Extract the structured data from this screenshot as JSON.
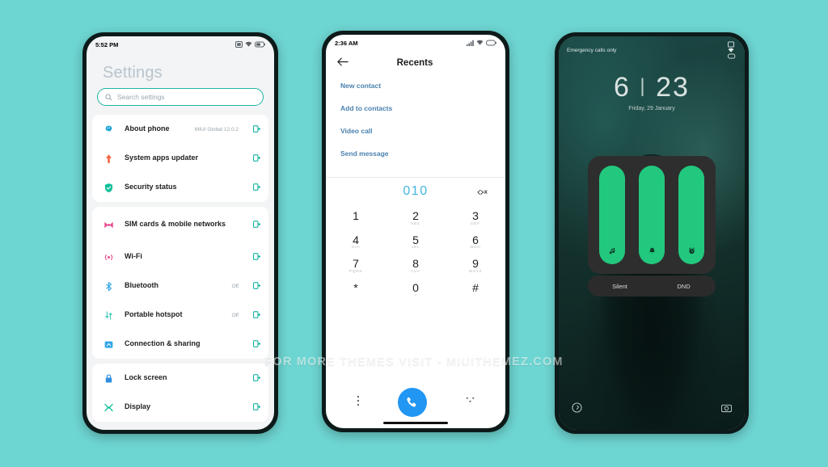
{
  "background_color": "#6ed6d2",
  "watermark": "FOR MORE THEMES VISIT - MIUITHEMEZ.COM",
  "accent_colors": {
    "teal": "#16b5a3",
    "link_blue": "#4a81ad",
    "dial_blue": "#44b6e0",
    "call_button": "#2196f3",
    "volume_green": "#22c87e"
  },
  "settings_phone": {
    "status_bar": {
      "time": "5:52 PM",
      "icons": [
        "sim-icon",
        "wifi-icon",
        "battery-icon"
      ]
    },
    "title": "Settings",
    "search": {
      "placeholder": "Search settings",
      "icon": "search-icon"
    },
    "groups": [
      {
        "items": [
          {
            "label": "About phone",
            "value": "MIUI Global 12.0.2",
            "icon": "chip-icon",
            "icon_color": "#1fa6d8"
          },
          {
            "label": "System apps updater",
            "value": "",
            "icon": "arrow-up-icon",
            "icon_color": "#f4623f"
          },
          {
            "label": "Security status",
            "value": "",
            "icon": "shield-check-icon",
            "icon_color": "#0fbf9a"
          }
        ]
      },
      {
        "items": [
          {
            "label": "SIM cards & mobile networks",
            "value": "",
            "icon": "sim-card-icon",
            "icon_color": "#e8468c",
            "tall": true
          },
          {
            "label": "Wi-Fi",
            "value": "",
            "icon": "wifi-signal-icon",
            "icon_color": "#e8468c"
          },
          {
            "label": "Bluetooth",
            "value": "Off",
            "icon": "bluetooth-icon",
            "icon_color": "#35a8e8"
          },
          {
            "label": "Portable hotspot",
            "value": "Off",
            "icon": "hotspot-icon",
            "icon_color": "#3bc4b8"
          },
          {
            "label": "Connection & sharing",
            "value": "",
            "icon": "share-icon",
            "icon_color": "#35a8e8"
          }
        ]
      },
      {
        "items": [
          {
            "label": "Lock screen",
            "value": "",
            "icon": "lock-icon",
            "icon_color": "#2f8fe0"
          },
          {
            "label": "Display",
            "value": "",
            "icon": "display-icon",
            "icon_color": "#0fbf9a"
          }
        ]
      }
    ]
  },
  "dialer_phone": {
    "status_bar": {
      "time": "2:36 AM",
      "icons": [
        "signal-icon",
        "wifi-icon",
        "battery-icon"
      ]
    },
    "header": {
      "back_icon": "back-arrow-icon",
      "title": "Recents"
    },
    "actions": [
      "New contact",
      "Add to contacts",
      "Video call",
      "Send message"
    ],
    "dialed_number": "010",
    "delete_icon": "backspace-icon",
    "keys": [
      {
        "digit": "1",
        "sub": ""
      },
      {
        "digit": "2",
        "sub": "ABC"
      },
      {
        "digit": "3",
        "sub": "DEF"
      },
      {
        "digit": "4",
        "sub": "GHI"
      },
      {
        "digit": "5",
        "sub": "JKL"
      },
      {
        "digit": "6",
        "sub": "MNO"
      },
      {
        "digit": "7",
        "sub": "PQRS"
      },
      {
        "digit": "8",
        "sub": "TUV"
      },
      {
        "digit": "9",
        "sub": "WXYZ"
      },
      {
        "digit": "*",
        "sub": ""
      },
      {
        "digit": "0",
        "sub": "+"
      },
      {
        "digit": "#",
        "sub": ""
      }
    ],
    "bottom_bar": {
      "more_icon": "more-vertical-icon",
      "call_icon": "phone-call-icon",
      "keypad_toggle_icon": "dialpad-icon"
    }
  },
  "lock_phone": {
    "status_bar": {
      "text": "Emergency calls only",
      "icons": [
        "sim-icon",
        "wifi-icon",
        "battery-icon"
      ]
    },
    "clock": {
      "hour": "6",
      "separator": "|",
      "minute": "23"
    },
    "date": "Friday, 29 January",
    "volume_panel": {
      "sliders": [
        {
          "name": "media",
          "icon": "music-note-icon",
          "level": 100
        },
        {
          "name": "ring",
          "icon": "bell-icon",
          "level": 100
        },
        {
          "name": "alarm",
          "icon": "alarm-clock-icon",
          "level": 100
        }
      ],
      "buttons": [
        "Silent",
        "DND"
      ]
    },
    "shortcuts": {
      "left_icon": "flashlight-icon",
      "right_icon": "camera-icon"
    }
  }
}
